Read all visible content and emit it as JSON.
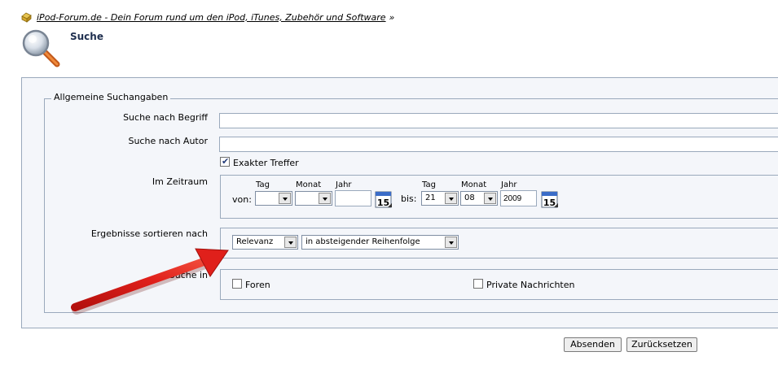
{
  "breadcrumb": {
    "link": "iPod-Forum.de - Dein Forum rund um den iPod, iTunes, Zubehör und Software",
    "separator": "»"
  },
  "page": {
    "title": "Suche"
  },
  "form": {
    "legend": "Allgemeine Suchangaben",
    "keyword_label": "Suche nach Begriff",
    "keyword_value": "",
    "author_label": "Suche nach Autor",
    "author_value": "",
    "exact_label": "Exakter Treffer",
    "exact_checked": true,
    "period_label": "Im Zeitraum",
    "from_label": "von:",
    "to_label": "bis:",
    "day_label": "Tag",
    "month_label": "Monat",
    "year_label": "Jahr",
    "from_day": "",
    "from_month": "",
    "from_year": "",
    "to_day": "21",
    "to_month": "08",
    "to_year": "2009",
    "calendar_day": "15",
    "sort_label": "Ergebnisse sortieren nach",
    "sort_field": "Relevanz",
    "sort_order": "in absteigender Reihenfolge",
    "search_in_label": "Suche in",
    "search_in_forums": "Foren",
    "search_in_pm": "Private Nachrichten"
  },
  "actions": {
    "submit": "Absenden",
    "reset": "Zurücksetzen"
  },
  "colors": {
    "arrow": "#e0201b",
    "panel_bg": "#f4f6fa",
    "border": "#9aa9bc",
    "title": "#1f2f4f"
  }
}
